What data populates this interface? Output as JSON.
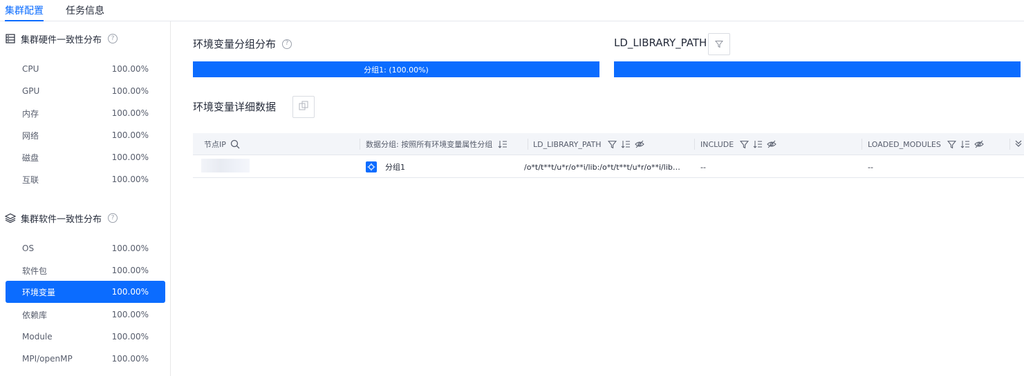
{
  "tabs": [
    {
      "label": "集群配置",
      "active": true
    },
    {
      "label": "任务信息",
      "active": false
    }
  ],
  "sidebar": {
    "hardware": {
      "title": "集群硬件一致性分布",
      "items": [
        {
          "label": "CPU",
          "value": "100.00%"
        },
        {
          "label": "GPU",
          "value": "100.00%"
        },
        {
          "label": "内存",
          "value": "100.00%"
        },
        {
          "label": "网络",
          "value": "100.00%"
        },
        {
          "label": "磁盘",
          "value": "100.00%"
        },
        {
          "label": "互联",
          "value": "100.00%"
        }
      ]
    },
    "software": {
      "title": "集群软件一致性分布",
      "items": [
        {
          "label": "OS",
          "value": "100.00%"
        },
        {
          "label": "软件包",
          "value": "100.00%"
        },
        {
          "label": "环境变量",
          "value": "100.00%",
          "selected": true
        },
        {
          "label": "依赖库",
          "value": "100.00%"
        },
        {
          "label": "Module",
          "value": "100.00%"
        },
        {
          "label": "MPI/openMP",
          "value": "100.00%"
        }
      ]
    }
  },
  "main": {
    "dist_title": "环境变量分组分布",
    "dist_bar_label": "分组1: (100.00%)",
    "dist_bar_fraction": 1.0,
    "var_name": "LD_LIBRARY_PATH",
    "var_bar_fraction": 1.0,
    "detail_title": "环境变量详细数据"
  },
  "table": {
    "headers": {
      "ip": "节点IP",
      "group": "数据分组: 按照所有环境变量属性分组",
      "ld": "LD_LIBRARY_PATH",
      "include": "INCLUDE",
      "loaded": "LOADED_MODULES"
    },
    "rows": [
      {
        "ip": "",
        "group": "分组1",
        "ld": "/o*t/t**t/u*r/o**i/lib:/o*t/t**t/u*r/o**i/lib…",
        "include": "--",
        "loaded": "--"
      }
    ]
  },
  "colors": {
    "accent": "#0b6cff",
    "header_bg": "#f3f5f9",
    "border": "#e4e7ed"
  },
  "icons": [
    "server-icon",
    "layers-icon",
    "help-icon",
    "filter-icon",
    "copy-icon",
    "search-icon",
    "sort-icon",
    "eye-off-icon",
    "expand-icon",
    "group-icon"
  ]
}
